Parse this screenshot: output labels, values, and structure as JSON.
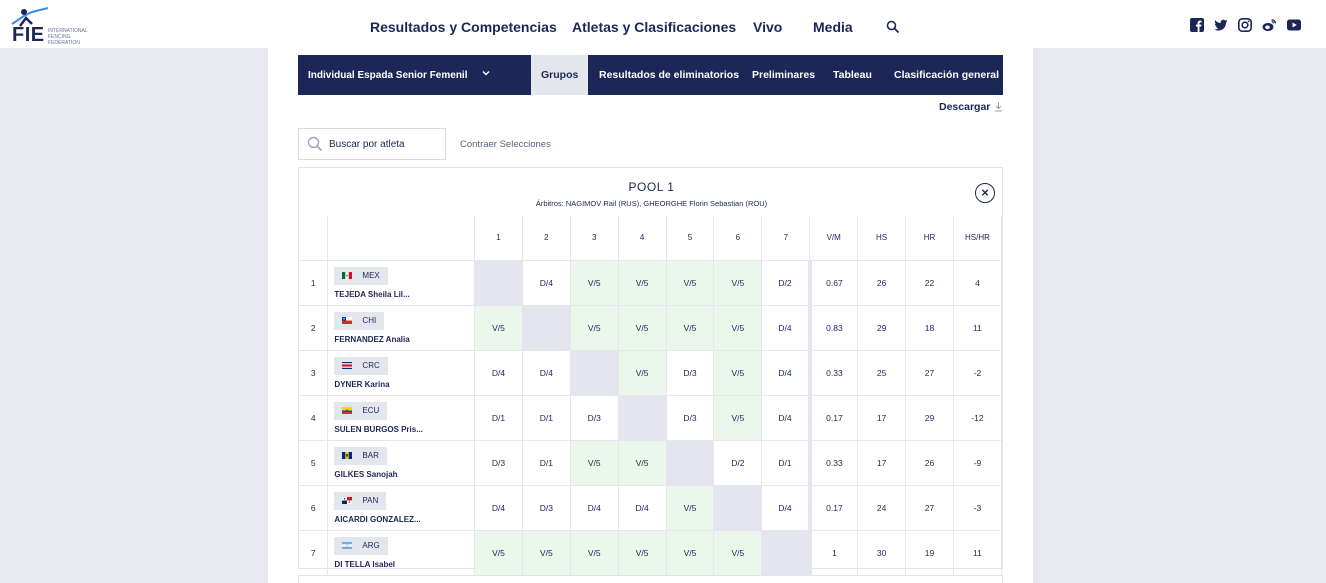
{
  "brand": {
    "logo_text": "FIE",
    "logo_sub": "International Fencing Federation"
  },
  "nav": {
    "items": [
      "Resultados y Competencias",
      "Atletas y Clasificaciones",
      "Vivo",
      "Media"
    ]
  },
  "competition": {
    "dropdown_label": "Individual Espada Senior Femenil",
    "tabs": [
      "Grupos",
      "Resultados de eliminatorios",
      "Preliminares",
      "Tableau",
      "Clasificación general"
    ],
    "active_tab": "Grupos"
  },
  "download_label": "Descargar",
  "search": {
    "placeholder": "Buscar por atleta"
  },
  "collapse_label": "Contraer Selecciones",
  "pool": {
    "title": "POOL 1",
    "referees": "Árbitros: NAGIMOV Rail (RUS), GHEORGHE Florin Sebastian (ROU)",
    "headers": [
      "1",
      "2",
      "3",
      "4",
      "5",
      "6",
      "7",
      "V/M",
      "HS",
      "HR",
      "HS/HR"
    ],
    "rows": [
      {
        "idx": "1",
        "country": "MEX",
        "name": "TEJEDA Sheila Lil...",
        "flag": "mex",
        "bouts": [
          "",
          "D/4",
          "V/5",
          "V/5",
          "V/5",
          "V/5",
          "D/2"
        ],
        "vm": "0.67",
        "hs": "26",
        "hr": "22",
        "ind": "4"
      },
      {
        "idx": "2",
        "country": "CHI",
        "name": "FERNANDEZ Analia",
        "flag": "chi",
        "bouts": [
          "V/5",
          "",
          "V/5",
          "V/5",
          "V/5",
          "V/5",
          "D/4"
        ],
        "vm": "0.83",
        "hs": "29",
        "hr": "18",
        "ind": "11"
      },
      {
        "idx": "3",
        "country": "CRC",
        "name": "DYNER Karina",
        "flag": "crc",
        "bouts": [
          "D/4",
          "D/4",
          "",
          "V/5",
          "D/3",
          "V/5",
          "D/4"
        ],
        "vm": "0.33",
        "hs": "25",
        "hr": "27",
        "ind": "-2"
      },
      {
        "idx": "4",
        "country": "ECU",
        "name": "SULEN BURGOS Pris...",
        "flag": "ecu",
        "bouts": [
          "D/1",
          "D/1",
          "D/3",
          "",
          "D/3",
          "V/5",
          "D/4"
        ],
        "vm": "0.17",
        "hs": "17",
        "hr": "29",
        "ind": "-12"
      },
      {
        "idx": "5",
        "country": "BAR",
        "name": "GILKES Sanojah",
        "flag": "bar",
        "bouts": [
          "D/3",
          "D/1",
          "V/5",
          "V/5",
          "",
          "D/2",
          "D/1"
        ],
        "vm": "0.33",
        "hs": "17",
        "hr": "26",
        "ind": "-9"
      },
      {
        "idx": "6",
        "country": "PAN",
        "name": "AICARDI GONZALEZ...",
        "flag": "pan",
        "bouts": [
          "D/4",
          "D/3",
          "D/4",
          "D/4",
          "V/5",
          "",
          "D/4"
        ],
        "vm": "0.17",
        "hs": "24",
        "hr": "27",
        "ind": "-3"
      },
      {
        "idx": "7",
        "country": "ARG",
        "name": "DI TELLA Isabel",
        "flag": "arg",
        "bouts": [
          "V/5",
          "V/5",
          "V/5",
          "V/5",
          "V/5",
          "V/5",
          ""
        ],
        "vm": "1",
        "hs": "30",
        "hr": "19",
        "ind": "11"
      }
    ]
  },
  "colors": {
    "navy": "#1c2657",
    "win_bg": "#ebf7ea",
    "self_bg": "#e4e5ee",
    "page_bg": "#e8e8f0"
  },
  "icons": [
    "search-icon",
    "facebook-icon",
    "twitter-icon",
    "instagram-icon",
    "weibo-icon",
    "youtube-icon",
    "chevron-down-icon",
    "download-icon",
    "close-icon"
  ]
}
